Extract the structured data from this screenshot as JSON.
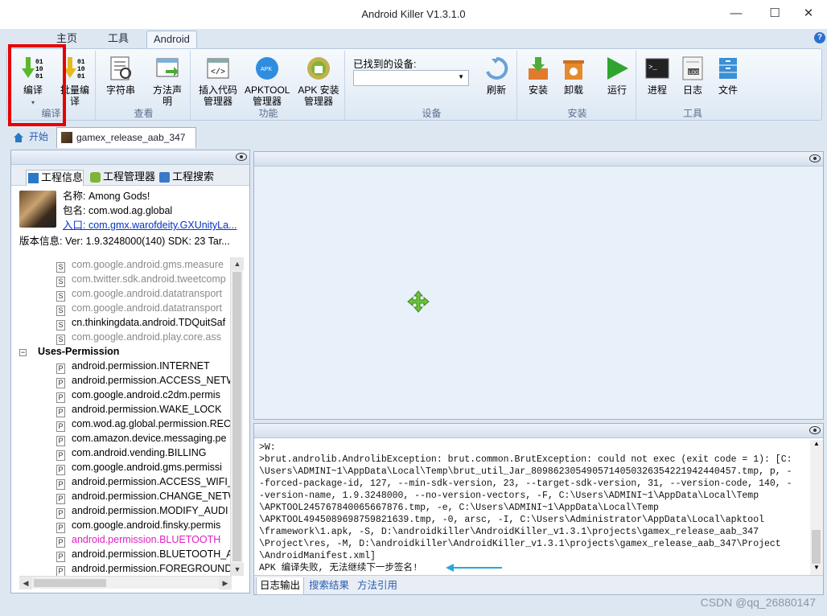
{
  "window": {
    "title": "Android Killer V1.3.1.0",
    "minimize": "—",
    "maximize": "☐",
    "close": "✕",
    "help": "?"
  },
  "ribbon_tabs": [
    "主页",
    "工具",
    "Android"
  ],
  "ribbon": {
    "compile": "编译",
    "batch_compile": "批量编译",
    "strings": "字符串",
    "method_declare": "方法声明",
    "insert_code": "插入代码管理器",
    "apktool": "APKTOOL管理器",
    "apk_install": "APK 安装管理器",
    "found_devices": "已找到的设备:",
    "refresh": "刷新",
    "install": "安装",
    "uninstall": "卸载",
    "run": "运行",
    "process": "进程",
    "log": "日志",
    "file": "文件",
    "groups": {
      "compile": "编译",
      "view": "查看",
      "function": "功能",
      "device": "设备",
      "install": "安装",
      "tools": "工具"
    }
  },
  "doc_tabs": {
    "start": "开始",
    "project": "gamex_release_aab_347"
  },
  "left": {
    "subtabs": [
      "工程信息",
      "工程管理器",
      "工程搜索"
    ],
    "name": "名称:  Among Gods!",
    "package": "包名:  com.wod.ag.global",
    "entry": "入口:  com.gmx.warofdeity.GXUnityLa...",
    "version": "版本信息:  Ver:  1.9.3248000(140) SDK:  23 Tar...",
    "tree": [
      {
        "t": "com.google.android.gms.measure",
        "k": "S",
        "grey": true
      },
      {
        "t": "com.twitter.sdk.android.tweetcomp",
        "k": "S",
        "grey": true
      },
      {
        "t": "com.google.android.datatransport",
        "k": "S",
        "grey": true
      },
      {
        "t": "com.google.android.datatransport",
        "k": "S",
        "grey": true
      },
      {
        "t": "cn.thinkingdata.android.TDQuitSaf",
        "k": "S",
        "grey": false
      },
      {
        "t": "com.google.android.play.core.ass",
        "k": "S",
        "grey": true
      },
      {
        "t": "Uses-Permission",
        "k": "head"
      },
      {
        "t": "android.permission.INTERNET",
        "k": "P"
      },
      {
        "t": "android.permission.ACCESS_NETW",
        "k": "P"
      },
      {
        "t": "com.google.android.c2dm.permis",
        "k": "P"
      },
      {
        "t": "android.permission.WAKE_LOCK",
        "k": "P"
      },
      {
        "t": "com.wod.ag.global.permission.REC",
        "k": "P"
      },
      {
        "t": "com.amazon.device.messaging.pe",
        "k": "P"
      },
      {
        "t": "com.android.vending.BILLING",
        "k": "P"
      },
      {
        "t": "com.google.android.gms.permissi",
        "k": "P"
      },
      {
        "t": "android.permission.ACCESS_WIFI_",
        "k": "P"
      },
      {
        "t": "android.permission.CHANGE_NETW",
        "k": "P"
      },
      {
        "t": "android.permission.MODIFY_AUDI",
        "k": "P"
      },
      {
        "t": "com.google.android.finsky.permis",
        "k": "P"
      },
      {
        "t": "android.permission.BLUETOOTH",
        "k": "P",
        "pink": true
      },
      {
        "t": "android.permission.BLUETOOTH_A",
        "k": "P"
      },
      {
        "t": "android.permission.FOREGROUND",
        "k": "P"
      }
    ]
  },
  "console": {
    "lines": [
      ">W:",
      ">brut.androlib.AndrolibException: brut.common.BrutException: could not exec (exit code = 1): [C:",
      "\\Users\\ADMINI~1\\AppData\\Local\\Temp\\brut_util_Jar_8098623054905714050326354221942440457.tmp, p, -",
      "-forced-package-id, 127, --min-sdk-version, 23, --target-sdk-version, 31, --version-code, 140, -",
      "-version-name, 1.9.3248000, --no-version-vectors, -F, C:\\Users\\ADMINI~1\\AppData\\Local\\Temp",
      "\\APKTOOL245767840065667876.tmp, -e, C:\\Users\\ADMINI~1\\AppData\\Local\\Temp",
      "\\APKTOOL4945089698759821639.tmp, -0, arsc, -I, C:\\Users\\Administrator\\AppData\\Local\\apktool",
      "\\framework\\1.apk, -S, D:\\androidkiller\\AndroidKiller_v1.3.1\\projects\\gamex_release_aab_347",
      "\\Project\\res, -M, D:\\androidkiller\\AndroidKiller_v1.3.1\\projects\\gamex_release_aab_347\\Project",
      "\\AndroidManifest.xml]",
      "APK 编译失败, 无法继续下一步签名!"
    ],
    "tabs": [
      "日志输出",
      "搜索结果",
      "方法引用"
    ]
  },
  "watermark": "CSDN @qq_26880147"
}
